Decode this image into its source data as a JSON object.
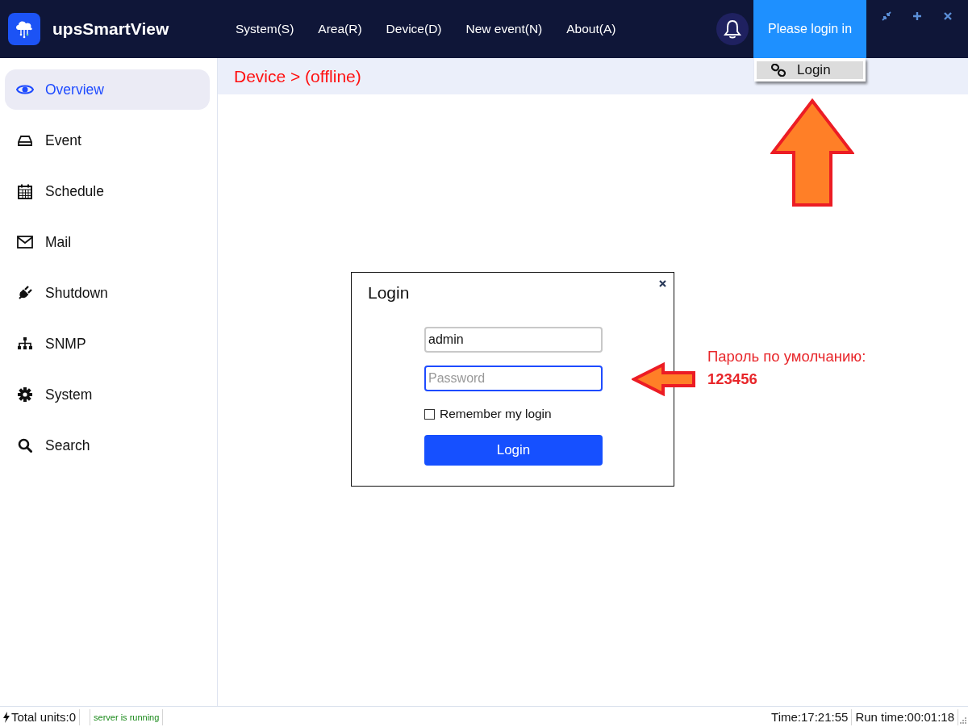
{
  "app": {
    "title": "upsSmartView"
  },
  "menu": [
    "System(S)",
    "Area(R)",
    "Device(D)",
    "New event(N)",
    "About(A)"
  ],
  "login_status": "Please login in",
  "account_menu": {
    "items": [
      "Login"
    ]
  },
  "sidebar": {
    "items": [
      {
        "label": "Overview",
        "selected": true
      },
      {
        "label": "Event",
        "selected": false
      },
      {
        "label": "Schedule",
        "selected": false
      },
      {
        "label": "Mail",
        "selected": false
      },
      {
        "label": "Shutdown",
        "selected": false
      },
      {
        "label": "SNMP",
        "selected": false
      },
      {
        "label": "System",
        "selected": false
      },
      {
        "label": "Search",
        "selected": false
      }
    ]
  },
  "breadcrumb": "Device > (offline)",
  "login_dialog": {
    "title": "Login",
    "username": {
      "value": "admin"
    },
    "password": {
      "placeholder": "Password",
      "focused": true
    },
    "remember": {
      "label": "Remember my login",
      "checked": false
    },
    "submit": "Login"
  },
  "annotation": {
    "text": "Пароль по умолчанию:",
    "value": "123456"
  },
  "status_bar": {
    "total_units": "Total units:0",
    "server_status": "server is running",
    "time": "Time:17:21:55",
    "run_time": "Run time:00:01:18"
  }
}
